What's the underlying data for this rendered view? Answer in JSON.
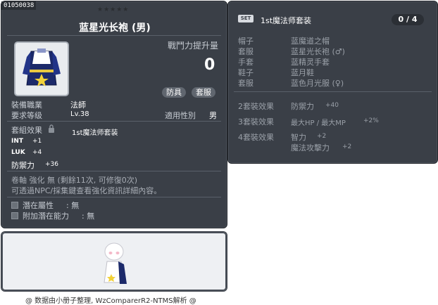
{
  "item": {
    "id_code": "01050038",
    "stars": "★★★★★",
    "name": "蓝星光长袍 (男)",
    "power_label": "戰鬥力提升量",
    "power_value": "0",
    "tags": [
      "防具",
      "套服"
    ],
    "job_label": "裝備職業",
    "job_value": "法師",
    "level_label": "要求等级",
    "level_value": "Lv.38",
    "gender_label": "適用性別",
    "gender_value": "男",
    "set_effect_label": "套組效果",
    "set_effect_value": "1st魔法师套装",
    "stats": [
      {
        "name": "INT",
        "value": "+1"
      },
      {
        "name": "LUK",
        "value": "+4"
      },
      {
        "name": "防禦力",
        "value": "+36"
      }
    ],
    "scroll_line": "卷軸 強化 無 (剩餘11次, 可修復0次)",
    "npc_line": "可透過NPC/採集鍵查看強化資訊詳細內容。",
    "potential_label": "潛在屬性",
    "potential_value": ": 無",
    "bonus_label": "附加潛在能力",
    "bonus_value": ": 無"
  },
  "footer": "@ 数据由小册子整理, WzComparerR2-NTMS解析 @",
  "set_panel": {
    "badge": "SET",
    "name": "1st魔法师套装",
    "count": "0 / 4",
    "pieces": [
      {
        "slot": "帽子",
        "name": "蓝魔道之帽"
      },
      {
        "slot": "套服",
        "name": "蓝星光长袍 (♂)"
      },
      {
        "slot": "手套",
        "name": "蓝精灵手套"
      },
      {
        "slot": "鞋子",
        "name": "蓝月鞋"
      },
      {
        "slot": "套服",
        "name": "蓝色月光服 (♀)"
      }
    ],
    "effects": [
      {
        "label": "2套裝效果",
        "lines": [
          {
            "name": "防禦力",
            "value": "+40"
          }
        ]
      },
      {
        "label": "3套裝效果",
        "lines": [
          {
            "name": "最大HP / 最大MP",
            "value": "+2%"
          }
        ]
      },
      {
        "label": "4套裝效果",
        "lines": [
          {
            "name": "智力",
            "value": "+2"
          },
          {
            "name": "魔法攻擊力",
            "value": "+2"
          }
        ]
      }
    ]
  },
  "colors": {
    "panel": "#3a3f47",
    "border": "#22252a",
    "text": "#ffffff",
    "label": "#c6cbd2"
  }
}
